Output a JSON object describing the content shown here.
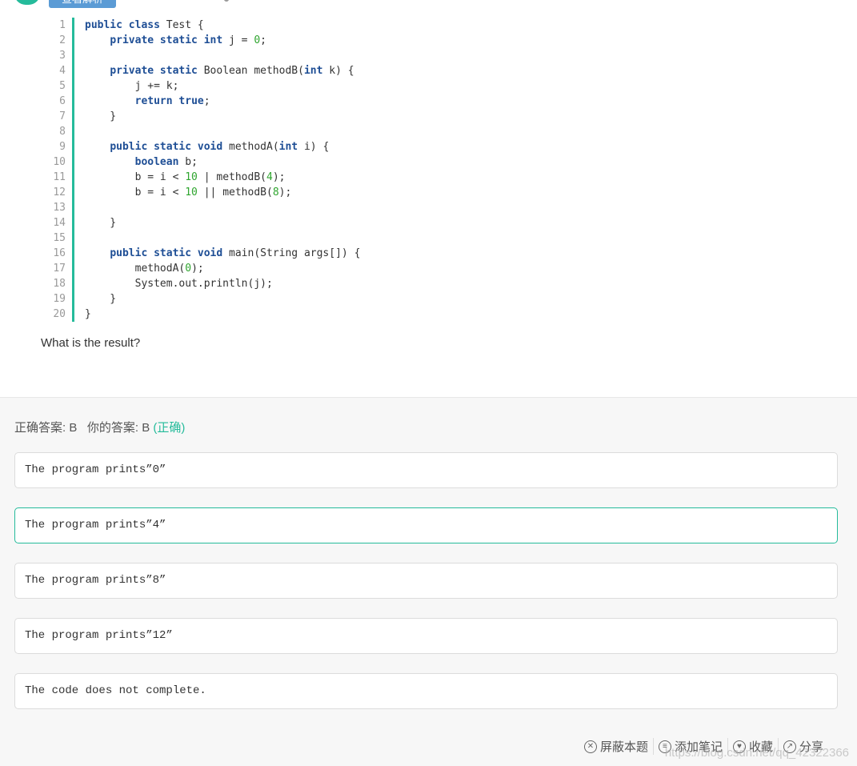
{
  "header": {
    "view_analysis_label": "查看解析"
  },
  "code": {
    "line_numbers": [
      "1",
      "2",
      "3",
      "4",
      "5",
      "6",
      "7",
      "8",
      "9",
      "10",
      "11",
      "12",
      "13",
      "14",
      "15",
      "16",
      "17",
      "18",
      "19",
      "20"
    ]
  },
  "question": {
    "text": "What is the result?"
  },
  "answer": {
    "correct_label": "正确答案: B",
    "yours_label": "你的答案: B",
    "status": "(正确)"
  },
  "options": [
    {
      "text": "The program prints”0”"
    },
    {
      "text": "The program prints”4”"
    },
    {
      "text": "The program prints”8”"
    },
    {
      "text": "The program prints”12”"
    },
    {
      "text": "The code does not complete."
    }
  ],
  "footer": {
    "block": "屏蔽本题",
    "note": "添加笔记",
    "favorite": "收藏",
    "share": "分享"
  },
  "watermark": "https://blog.csdn.net/qq_42322366",
  "colors": {
    "accent": "#25bb9b",
    "keyword": "#1e4e95",
    "number": "#2fa52f"
  }
}
